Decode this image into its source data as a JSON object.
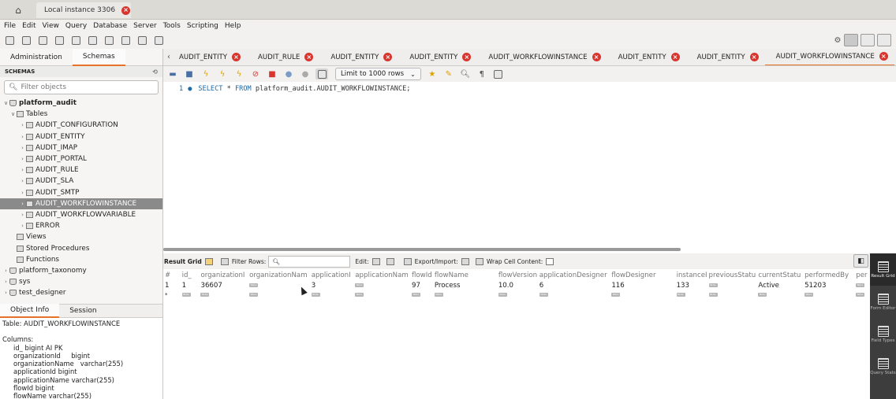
{
  "connection_tab": {
    "label": "Local instance 3306"
  },
  "menu": [
    "File",
    "Edit",
    "View",
    "Query",
    "Database",
    "Server",
    "Tools",
    "Scripting",
    "Help"
  ],
  "sidebar": {
    "tabs": [
      "Administration",
      "Schemas"
    ],
    "active_tab": "Schemas",
    "header": "SCHEMAS",
    "filter_placeholder": "Filter objects",
    "tree": {
      "schema": "platform_audit",
      "tables_label": "Tables",
      "tables": [
        "AUDIT_CONFIGURATION",
        "AUDIT_ENTITY",
        "AUDIT_IMAP",
        "AUDIT_PORTAL",
        "AUDIT_RULE",
        "AUDIT_SLA",
        "AUDIT_SMTP",
        "AUDIT_WORKFLOWINSTANCE",
        "AUDIT_WORKFLOWVARIABLE",
        "ERROR"
      ],
      "selected_table": "AUDIT_WORKFLOWINSTANCE",
      "views_label": "Views",
      "procedures_label": "Stored Procedures",
      "functions_label": "Functions",
      "other_schemas": [
        "platform_taxonomy",
        "sys",
        "test_designer"
      ]
    }
  },
  "info_panel": {
    "tabs": [
      "Object Info",
      "Session"
    ],
    "table_line": "Table: AUDIT_WORKFLOWINSTANCE",
    "columns_label": "Columns:",
    "columns": [
      {
        "name": "id_",
        "type": "bigint AI PK"
      },
      {
        "name": "organizationId",
        "type": "bigint"
      },
      {
        "name": "organizationName",
        "type": "varchar(255)"
      },
      {
        "name": "applicationId",
        "type": "bigint"
      },
      {
        "name": "applicationName",
        "type": "varchar(255)"
      },
      {
        "name": "flowId",
        "type": "bigint"
      },
      {
        "name": "flowName",
        "type": "varchar(255)"
      }
    ]
  },
  "editor_tabs": [
    "AUDIT_ENTITY",
    "AUDIT_RULE",
    "AUDIT_ENTITY",
    "AUDIT_ENTITY",
    "AUDIT_WORKFLOWINSTANCE",
    "AUDIT_ENTITY",
    "AUDIT_ENTITY",
    "AUDIT_WORKFLOWINSTANCE"
  ],
  "active_editor_tab": 7,
  "query_toolbar": {
    "limit": "Limit to 1000 rows"
  },
  "editor": {
    "line_number": "1",
    "kw1": "SELECT",
    "star": "*",
    "kw2": "FROM",
    "target": "platform_audit.AUDIT_WORKFLOWINSTANCE;"
  },
  "result_toolbar": {
    "result_grid": "Result Grid",
    "filter_rows": "Filter Rows:",
    "edit": "Edit:",
    "export_import": "Export/Import:",
    "wrap": "Wrap Cell Content:"
  },
  "grid": {
    "columns": [
      "#",
      "id_",
      "organizationI",
      "organizationNam",
      "applicationI",
      "applicationNam",
      "flowId",
      "flowName",
      "flowVersion",
      "applicationDesigner",
      "flowDesigner",
      "instanceI",
      "previousStatu",
      "currentStatu",
      "performedBy",
      "per"
    ],
    "row": [
      "1",
      "1",
      "36607",
      "NULL",
      "3",
      "NULL",
      "97",
      "Process",
      "10.0",
      "6",
      "116",
      "133",
      "NULL",
      "Active",
      "51203",
      "NULL"
    ],
    "new_row_marker": "*",
    "null_label": "NULL"
  },
  "right_panel": [
    {
      "label": "Result Grid",
      "active": true
    },
    {
      "label": "Form Editor",
      "active": false
    },
    {
      "label": "Field Types",
      "active": false
    },
    {
      "label": "Query Stats",
      "active": false
    }
  ],
  "colors": {
    "accent": "#e4722a",
    "close": "#d8352f",
    "selection": "#8a8a8a",
    "sql_keyword": "#1c6aa8"
  }
}
